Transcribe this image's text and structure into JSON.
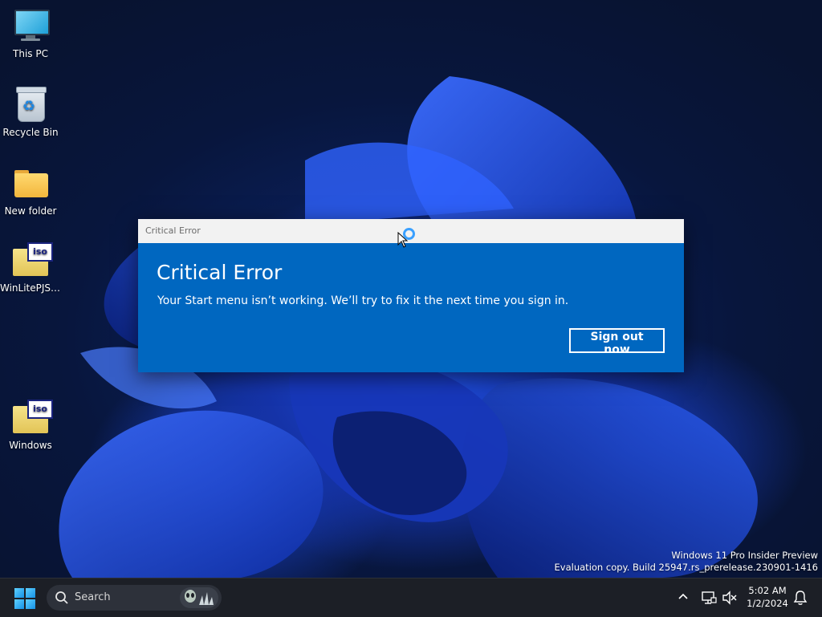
{
  "desktop": {
    "icons": [
      {
        "label": "This PC",
        "icon": "computer-icon"
      },
      {
        "label": "Recycle Bin",
        "icon": "recycle-bin-icon"
      },
      {
        "label": "New folder",
        "icon": "folder-icon"
      },
      {
        "label": "WinLitePJSK...",
        "icon": "iso-file-icon"
      },
      {
        "label": "Windows",
        "icon": "iso-file-icon"
      }
    ],
    "iso_badge": "iso",
    "watermark": {
      "line1": "Windows 11 Pro Insider Preview",
      "line2": "Evaluation copy. Build 25947.rs_prerelease.230901-1416"
    }
  },
  "dialog": {
    "window_title": "Critical Error",
    "heading": "Critical Error",
    "message": "Your Start menu isn’t working. We’ll try to fix it the next time you sign in.",
    "button_label": "Sign out now",
    "accent": "#0067c0"
  },
  "taskbar": {
    "search_placeholder": "Search",
    "clock": {
      "time": "5:02 AM",
      "date": "1/2/2024"
    },
    "tray_icons": [
      "chevron-up-icon",
      "network-icon",
      "volume-muted-icon",
      "notification-bell-icon"
    ]
  }
}
